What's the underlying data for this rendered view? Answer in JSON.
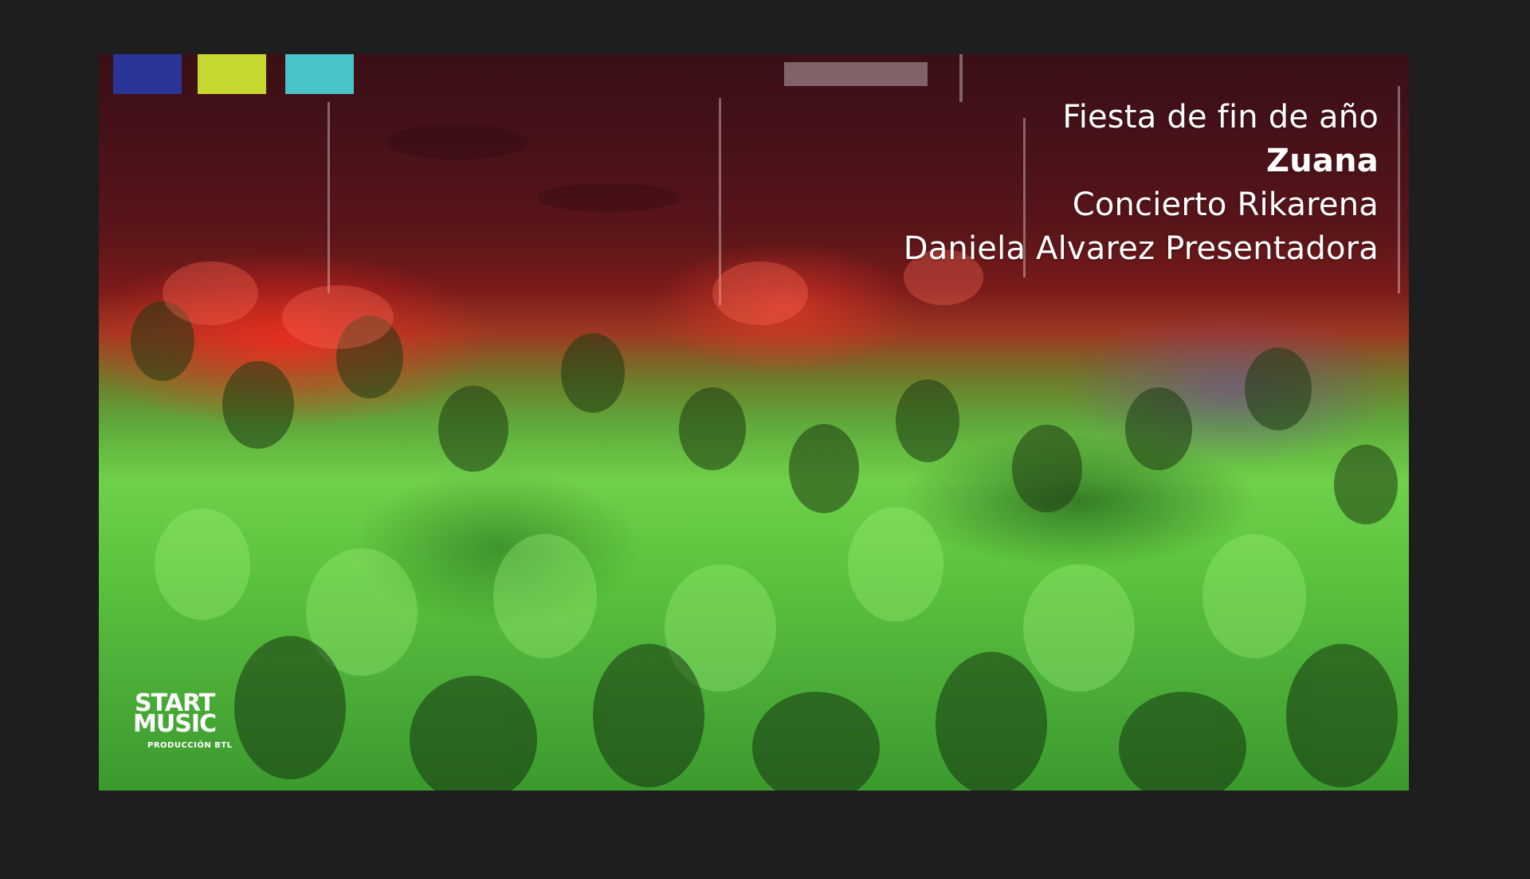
{
  "colors": {
    "background": "#1e1e1e",
    "swatch_blue": "#2b3597",
    "swatch_lime": "#c6d82f",
    "swatch_cyan": "#48c3c9",
    "caption_text": "#ffffff"
  },
  "photo": {
    "subject": "crowd-at-concert"
  },
  "captions": {
    "line1": "Fiesta de fin de año",
    "line2": "Zuana",
    "line3": "Concierto Rikarena",
    "line4": "Daniela Alvarez Presentadora"
  },
  "logo": {
    "word1": "START",
    "word2": "MUSIC",
    "tagline": "PRODUCCIÓN BTL"
  }
}
